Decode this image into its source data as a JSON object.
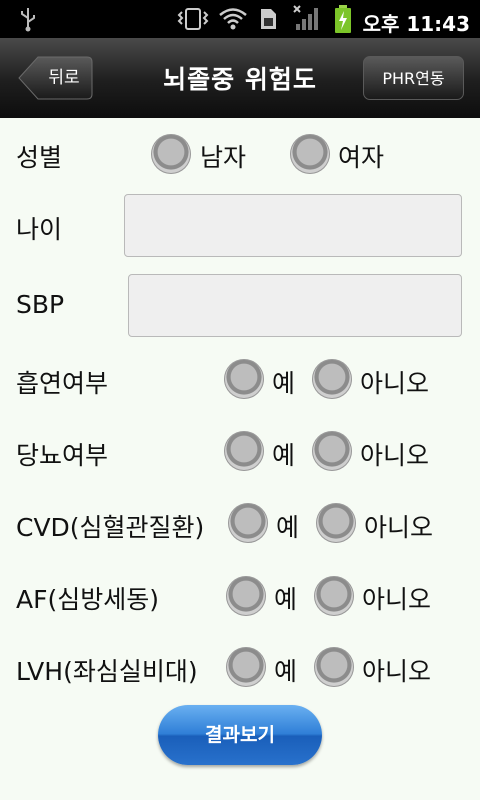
{
  "status_bar": {
    "time": "오후 11:43",
    "icons": [
      "usb-icon",
      "vibrate-icon",
      "wifi-icon",
      "sim-icon",
      "signal-icon",
      "battery-charging-icon"
    ]
  },
  "header": {
    "back_label": "뒤로",
    "title": "뇌졸중 위험도",
    "phr_label": "PHR연동"
  },
  "form": {
    "gender": {
      "label": "성별",
      "options": [
        "남자",
        "여자"
      ]
    },
    "age": {
      "label": "나이",
      "value": ""
    },
    "sbp": {
      "label": "SBP",
      "value": ""
    },
    "smoking": {
      "label": "흡연여부",
      "yes": "예",
      "no": "아니오"
    },
    "diabetes": {
      "label": "당뇨여부",
      "yes": "예",
      "no": "아니오"
    },
    "cvd": {
      "label": "CVD(심혈관질환)",
      "yes": "예",
      "no": "아니오"
    },
    "af": {
      "label": "AF(심방세동)",
      "yes": "예",
      "no": "아니오"
    },
    "lvh": {
      "label": "LVH(좌심실비대)",
      "yes": "예",
      "no": "아니오"
    }
  },
  "result_button": {
    "label": "결과보기"
  },
  "colors": {
    "background": "#f6fbf4",
    "button_blue": "#2f7fd7",
    "header_dark": "#1e1e1e"
  }
}
